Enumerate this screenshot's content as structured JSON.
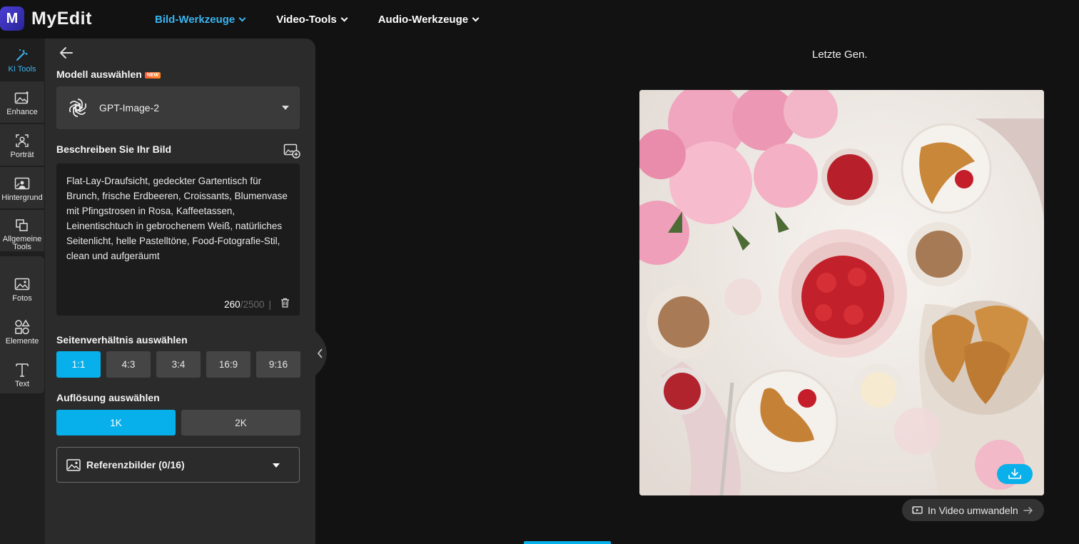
{
  "app": {
    "logo_letter": "M",
    "name": "MyEdit"
  },
  "nav": [
    {
      "label": "Bild-Werkzeuge",
      "active": true
    },
    {
      "label": "Video-Tools",
      "active": false
    },
    {
      "label": "Audio-Werkzeuge",
      "active": false
    }
  ],
  "rail": {
    "ki_tools": "KI Tools",
    "enhance": "Enhance",
    "portrait": "Porträt",
    "hintergrund": "Hintergrund",
    "allgemeine_tools": "Allgemeine Tools",
    "fotos": "Fotos",
    "elemente": "Elemente",
    "text": "Text"
  },
  "panel": {
    "model_label": "Modell auswählen",
    "new_badge": "NEW",
    "model_value": "GPT-Image-2",
    "describe_label": "Beschreiben Sie Ihr Bild",
    "prompt": "Flat-Lay-Draufsicht, gedeckter Gartentisch für Brunch, frische Erdbeeren, Croissants, Blumenvase mit Pfingstrosen in Rosa, Kaffeetassen, Leinentischtuch in gebrochenem Weiß, natürliches Seitenlicht, helle Pastelltöne, Food-Fotografie-Stil, clean und aufgeräumt",
    "char_count": "260",
    "char_max": "/2500",
    "char_sep": "|",
    "ratio_label": "Seitenverhältnis auswählen",
    "ratios": [
      "1:1",
      "4:3",
      "3:4",
      "16:9",
      "9:16"
    ],
    "selected_ratio": "1:1",
    "resolution_label": "Auflösung auswählen",
    "resolutions": [
      "1K",
      "2K"
    ],
    "selected_resolution": "1K",
    "reference_label": "Referenzbilder (0/16)"
  },
  "result": {
    "label": "Letzte Gen.",
    "to_video": "In Video umwandeln"
  },
  "colors": {
    "accent": "#07b0ea",
    "nav_active": "#3ab5f0",
    "panel_bg": "#2b2b2b",
    "page_bg": "#121212"
  }
}
